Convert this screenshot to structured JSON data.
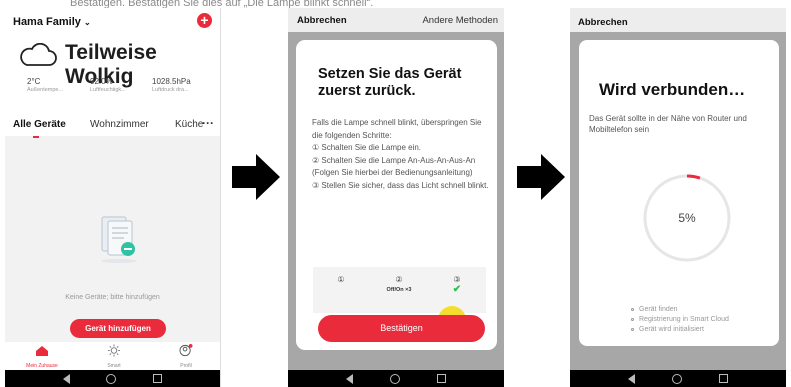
{
  "caption": "Bestätigen. Bestätigen Sie dies auf „Die Lampe blinkt schnell“.",
  "phone1": {
    "family": "Hama Family",
    "weather": "Teilweise Wolkig",
    "stats": [
      {
        "value": "2°C",
        "label": "Außentempe..."
      },
      {
        "value": "92.0%",
        "label": "Luftfeuchtigk..."
      },
      {
        "value": "1028.5hPa",
        "label": "Luftdruck dra..."
      }
    ],
    "tabs": [
      "Alle Geräte",
      "Wohnzimmer",
      "Küche"
    ],
    "more": "···",
    "empty_text": "Keine Geräte; bitte hinzufügen",
    "add_device": "Gerät hinzufügen",
    "bottom_nav": [
      {
        "label": "Mein Zuhause",
        "icon": "home-icon"
      },
      {
        "label": "Smart",
        "icon": "sun-icon"
      },
      {
        "label": "Profil",
        "icon": "profile-icon"
      }
    ],
    "accent": "#ea2b3c"
  },
  "phone2": {
    "cancel": "Abbrechen",
    "other_methods": "Andere Methoden",
    "title": "Setzen Sie das Gerät zuerst zurück.",
    "text": "Falls die Lampe schnell blinkt, überspringen Sie die folgenden Schritte:\n① Schalten Sie die Lampe ein.\n② Schalten Sie die Lampe An-Aus-An-Aus-An (Folgen Sie hierbei der Bedienungsanleitung)\n③ Stellen Sie sicher, dass das Licht schnell blinkt.",
    "steps": [
      {
        "num": "①",
        "sub": ""
      },
      {
        "num": "②",
        "sub": "Off/On ×3"
      },
      {
        "num": "③",
        "sub": "✔"
      }
    ],
    "confirm": "Bestätigen"
  },
  "phone3": {
    "cancel": "Abbrechen",
    "title": "Wird verbunden…",
    "desc": "Das Gerät sollte in der Nähe von Router und Mobiltelefon sein",
    "progress_percent": 5,
    "progress_label": "5%",
    "checklist": [
      "Gerät finden",
      "Registrierung in Smart Cloud",
      "Gerät wird initialisiert"
    ]
  }
}
